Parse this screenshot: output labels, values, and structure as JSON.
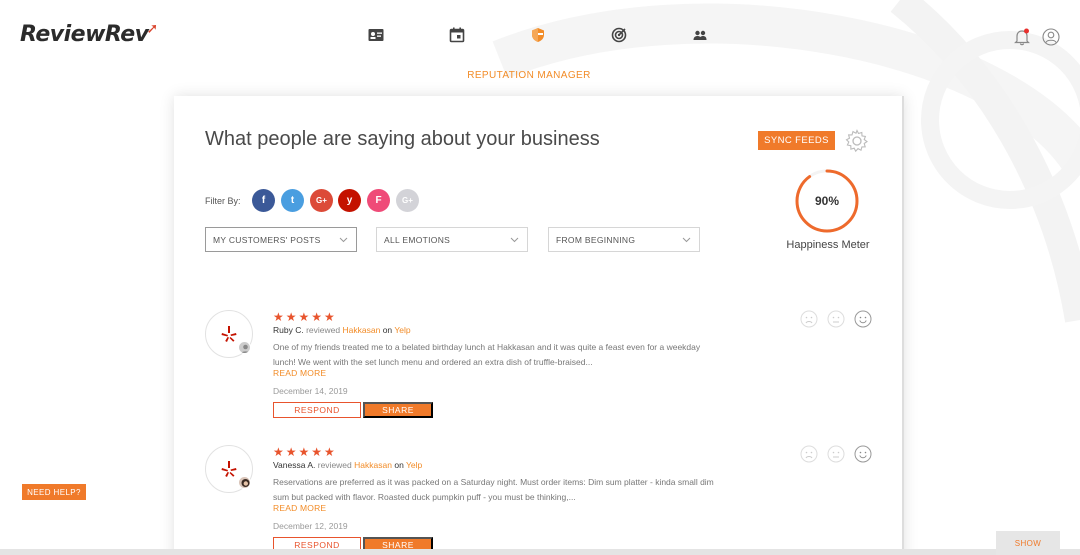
{
  "brand": {
    "logo_text": "ReviewRev",
    "accent": "#f07a2a",
    "star_color": "#e8542d"
  },
  "nav": {
    "icons": [
      "contact-card-icon",
      "calendar-icon",
      "shield-icon",
      "target-icon",
      "people-icon"
    ],
    "active_index": 2,
    "right_icons": [
      "bell-icon",
      "user-icon"
    ]
  },
  "page": {
    "section_label": "REPUTATION MANAGER"
  },
  "card": {
    "title": "What people are saying about your business",
    "sync_label": "SYNC FEEDS",
    "happiness": {
      "value_text": "90%",
      "value": 90,
      "label": "Happiness Meter"
    },
    "filter_label": "Filter By:",
    "socials": [
      {
        "name": "facebook",
        "glyph": "f",
        "color": "#3b5998"
      },
      {
        "name": "twitter",
        "glyph": "t",
        "color": "#4a9ee0"
      },
      {
        "name": "google-plus",
        "glyph": "G+",
        "color": "#dc4a38"
      },
      {
        "name": "yelp",
        "glyph": "y",
        "color": "#c41200"
      },
      {
        "name": "foursquare",
        "glyph": "F",
        "color": "#ef4b78"
      },
      {
        "name": "google-plus-disabled",
        "glyph": "G+",
        "color": "#d3d3d8"
      }
    ],
    "dropdowns": [
      {
        "value": "MY CUSTOMERS' POSTS"
      },
      {
        "value": "ALL EMOTIONS"
      },
      {
        "value": "FROM BEGINNING"
      }
    ]
  },
  "reviews": [
    {
      "stars": "★★★★★",
      "author": "Ruby C.",
      "reviewed_word": "reviewed",
      "business": "Hakkasan",
      "on_word": "on",
      "source": "Yelp",
      "text": "One of my friends treated me to a belated birthday lunch at Hakkasan and it was quite a feast even for a weekday lunch! We went with the set lunch menu and ordered an extra dish of truffle-braised...",
      "read_more": "READ MORE",
      "date": "December 14, 2019",
      "respond_label": "RESPOND",
      "share_label": "SHARE"
    },
    {
      "stars": "★★★★★",
      "author": "Vanessa A.",
      "reviewed_word": "reviewed",
      "business": "Hakkasan",
      "on_word": "on",
      "source": "Yelp",
      "text": "Reservations are preferred as it was packed on a Saturday night. Must order items: Dim sum platter - kinda small dim sum but packed with flavor. Roasted duck pumpkin puff - you must be thinking,...",
      "read_more": "READ MORE",
      "date": "December 12, 2019",
      "respond_label": "RESPOND",
      "share_label": "SHARE"
    }
  ],
  "widgets": {
    "need_help": "NEED HELP?",
    "show": "SHOW"
  }
}
